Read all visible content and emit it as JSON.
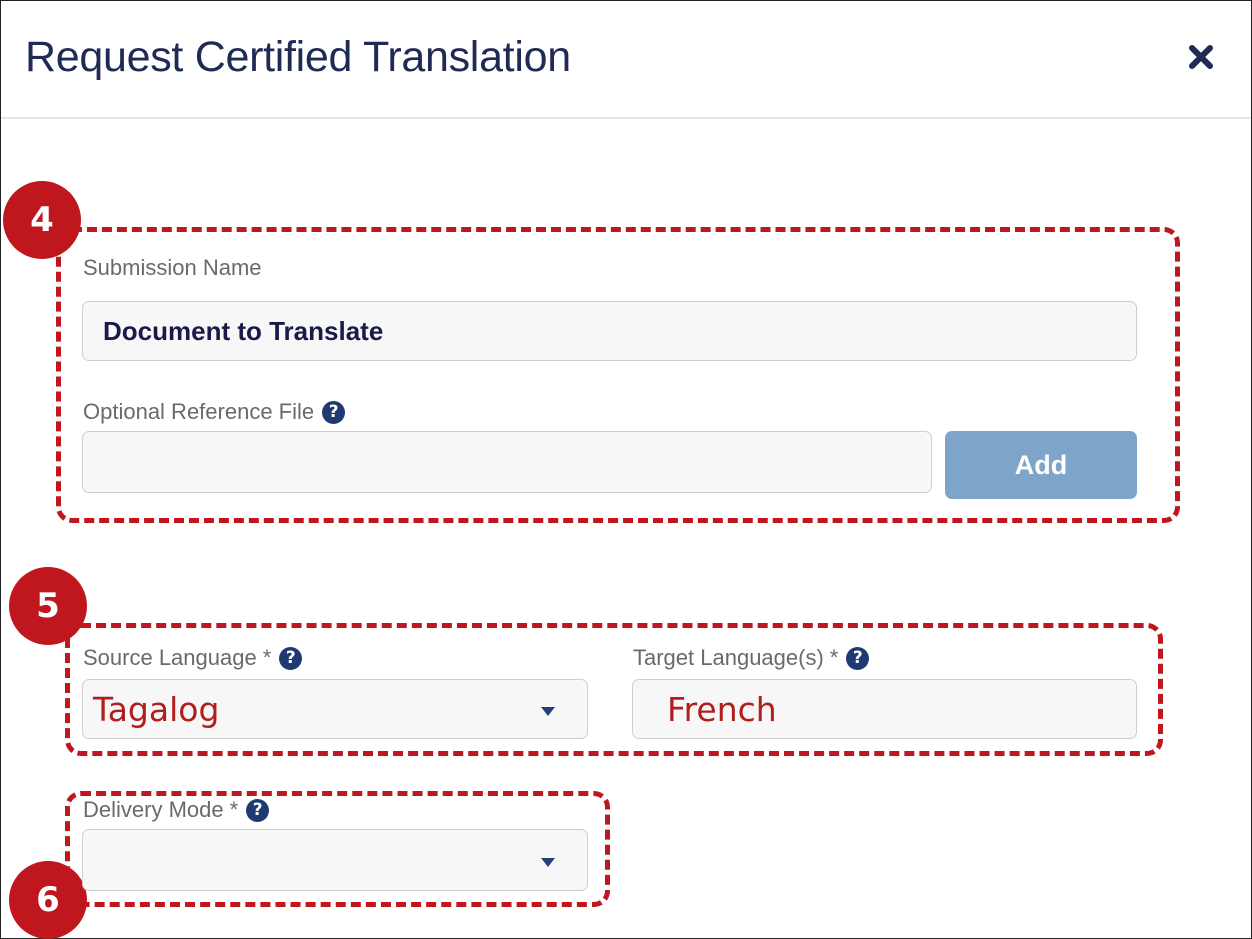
{
  "dialog": {
    "title": "Request Certified Translation"
  },
  "annotations": {
    "step4": "4",
    "step5": "5",
    "step6": "6"
  },
  "submission": {
    "label": "Submission Name",
    "value": "Document to Translate"
  },
  "reference_file": {
    "label": "Optional Reference File",
    "value": "",
    "add_label": "Add"
  },
  "source_language": {
    "label": "Source Language",
    "required_mark": "*",
    "value": "Tagalog"
  },
  "target_language": {
    "label": "Target Language(s)",
    "required_mark": "*",
    "value": "French"
  },
  "delivery_mode": {
    "label": "Delivery Mode",
    "required_mark": "*",
    "value": ""
  },
  "icons": {
    "close": "close-icon",
    "help": "question-circle-icon",
    "dropdown": "caret-down-icon"
  },
  "colors": {
    "title": "#1f2a55",
    "annotation": "#c0161d",
    "button": "#7ea5c9",
    "help_icon": "#1f3a73",
    "language_text": "#b01e1e"
  }
}
